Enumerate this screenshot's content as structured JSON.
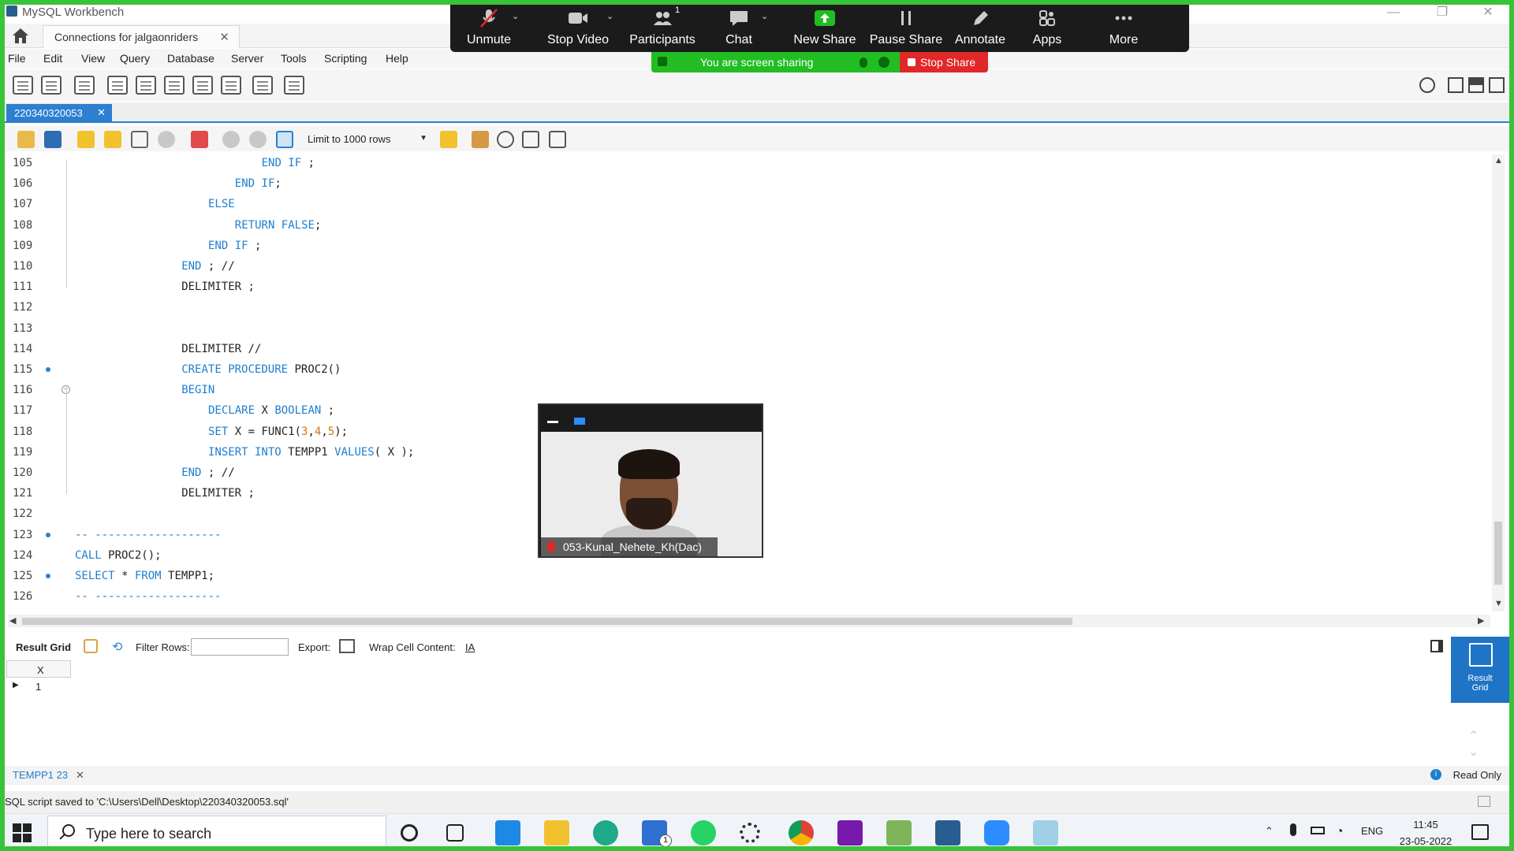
{
  "window": {
    "title": "MySQL Workbench",
    "controls": [
      "—",
      "❐",
      "✕"
    ]
  },
  "connection_tab": {
    "label": "Connections for jalgaonriders",
    "close": "✕"
  },
  "menu": [
    "File",
    "Edit",
    "View",
    "Query",
    "Database",
    "Server",
    "Tools",
    "Scripting",
    "Help"
  ],
  "toolbar_icons": [
    "new-sql-tab-icon",
    "open-sql-script-icon",
    "inspector-icon",
    "create-schema-icon",
    "create-table-icon",
    "create-view-icon",
    "create-procedure-icon",
    "create-function-icon",
    "search-table-data-icon",
    "reconnect-icon"
  ],
  "editor_tab": {
    "label": "220340320053",
    "close": "✕"
  },
  "sql_toolbar": {
    "limit": "Limit to 1000 rows",
    "icons": [
      "open-file-icon",
      "save-icon",
      "execute-icon",
      "execute-current-icon",
      "explain-icon",
      "stop-icon",
      "toggle-error-icon",
      "commit-icon",
      "rollback-icon",
      "autocommit-icon",
      "bookmark-icon",
      "beautify-icon",
      "find-icon",
      "invisible-chars-icon",
      "wrap-icon"
    ]
  },
  "code_lines": [
    {
      "n": "105",
      "indent": 28,
      "segs": [
        [
          "END IF",
          "kw"
        ],
        [
          " ;",
          ""
        ]
      ]
    },
    {
      "n": "106",
      "indent": 24,
      "segs": [
        [
          "END IF",
          "kw"
        ],
        [
          ";",
          ""
        ]
      ]
    },
    {
      "n": "107",
      "indent": 20,
      "segs": [
        [
          "ELSE",
          "kw"
        ]
      ]
    },
    {
      "n": "108",
      "indent": 24,
      "segs": [
        [
          "RETURN FALSE",
          "kw"
        ],
        [
          ";",
          ""
        ]
      ]
    },
    {
      "n": "109",
      "indent": 20,
      "segs": [
        [
          "END IF",
          "kw"
        ],
        [
          " ;",
          ""
        ]
      ]
    },
    {
      "n": "110",
      "indent": 16,
      "segs": [
        [
          "END",
          "kw"
        ],
        [
          " ; //",
          ""
        ]
      ]
    },
    {
      "n": "111",
      "indent": 16,
      "segs": [
        [
          "DELIMITER ;",
          ""
        ]
      ]
    },
    {
      "n": "112",
      "indent": 0,
      "segs": []
    },
    {
      "n": "113",
      "indent": 0,
      "segs": []
    },
    {
      "n": "114",
      "indent": 16,
      "segs": [
        [
          "DELIMITER //",
          ""
        ]
      ]
    },
    {
      "n": "115",
      "indent": 16,
      "mark": true,
      "segs": [
        [
          "CREATE PROCEDURE",
          "kw"
        ],
        [
          " PROC2()",
          ""
        ]
      ]
    },
    {
      "n": "116",
      "indent": 16,
      "fold": true,
      "segs": [
        [
          "BEGIN",
          "kw"
        ]
      ]
    },
    {
      "n": "117",
      "indent": 20,
      "segs": [
        [
          "DECLARE",
          "kw"
        ],
        [
          " X ",
          ""
        ],
        [
          "BOOLEAN",
          "kw"
        ],
        [
          " ;",
          ""
        ]
      ]
    },
    {
      "n": "118",
      "indent": 20,
      "segs": [
        [
          "SET",
          "kw"
        ],
        [
          " X = FUNC1(",
          ""
        ],
        [
          "3",
          "num"
        ],
        [
          ",",
          ""
        ],
        [
          "4",
          "num"
        ],
        [
          ",",
          ""
        ],
        [
          "5",
          "num"
        ],
        [
          ");",
          ""
        ]
      ]
    },
    {
      "n": "119",
      "indent": 20,
      "segs": [
        [
          "INSERT INTO",
          "kw"
        ],
        [
          " TEMPP1 ",
          ""
        ],
        [
          "VALUES",
          "kw"
        ],
        [
          "( X );",
          ""
        ]
      ]
    },
    {
      "n": "120",
      "indent": 16,
      "segs": [
        [
          "END",
          "kw"
        ],
        [
          " ; //",
          ""
        ]
      ]
    },
    {
      "n": "121",
      "indent": 16,
      "segs": [
        [
          "DELIMITER ;",
          ""
        ]
      ]
    },
    {
      "n": "122",
      "indent": 0,
      "segs": []
    },
    {
      "n": "123",
      "indent": 0,
      "mark": true,
      "segs": [
        [
          "-- -------------------",
          "cm"
        ]
      ]
    },
    {
      "n": "124",
      "indent": 0,
      "segs": [
        [
          "CALL",
          "kw"
        ],
        [
          " PROC2();",
          ""
        ]
      ]
    },
    {
      "n": "125",
      "indent": 0,
      "mark": true,
      "segs": [
        [
          "SELECT",
          "kw"
        ],
        [
          " * ",
          ""
        ],
        [
          "FROM",
          "kw"
        ],
        [
          " TEMPP1;",
          ""
        ]
      ]
    },
    {
      "n": "126",
      "indent": 0,
      "segs": [
        [
          "-- -------------------",
          "cm"
        ]
      ]
    }
  ],
  "result_toolbar": {
    "result_grid": "Result Grid",
    "filter_rows": "Filter Rows:",
    "export": "Export:",
    "wrap": "Wrap Cell Content:",
    "wrap_icon": "IA"
  },
  "result": {
    "columns": [
      "X"
    ],
    "rows": [
      [
        "1"
      ]
    ]
  },
  "side_panel": {
    "label_1": "Result",
    "label_2": "Grid"
  },
  "result_tab": {
    "label": "TEMPP1 23",
    "close": "✕"
  },
  "read_only": "Read Only",
  "status_message": "SQL script saved to 'C:\\Users\\Dell\\Desktop\\220340320053.sql'",
  "zoom": {
    "buttons": [
      {
        "label": "Unmute",
        "icon": "mic-off-icon",
        "caret": true
      },
      {
        "label": "Stop Video",
        "icon": "video-icon",
        "caret": true
      },
      {
        "label": "Participants",
        "icon": "participants-icon",
        "badge": "1"
      },
      {
        "label": "Chat",
        "icon": "chat-icon",
        "caret": true
      },
      {
        "label": "New Share",
        "icon": "share-icon",
        "accent": "#22bd22"
      },
      {
        "label": "Pause Share",
        "icon": "pause-icon"
      },
      {
        "label": "Annotate",
        "icon": "pencil-icon"
      },
      {
        "label": "Apps",
        "icon": "apps-icon"
      },
      {
        "label": "More",
        "icon": "more-icon"
      }
    ],
    "share_banner": "You are screen sharing",
    "stop_share": "Stop Share"
  },
  "video_tile": {
    "name": "053-Kunal_Nehete_Kh(Dac)"
  },
  "taskbar": {
    "search_placeholder": "Type here to search",
    "apps": [
      "cortana-icon",
      "task-view-icon",
      "vscode-icon",
      "file-explorer-icon",
      "edge-icon",
      "mail-icon",
      "whatsapp-icon",
      "settings-icon",
      "chrome-icon",
      "onenote-icon",
      "paint-icon",
      "mysql-workbench-icon",
      "zoom-icon",
      "notepad-icon"
    ],
    "mail_badge": "1",
    "lang": "ENG",
    "time": "11:45",
    "date": "23-05-2022"
  },
  "colors": {
    "accent": "#2d7fd0",
    "keyword": "#1e7fd0",
    "number": "#d9730d",
    "share_green": "#39c33a",
    "stop_red": "#e02828"
  }
}
